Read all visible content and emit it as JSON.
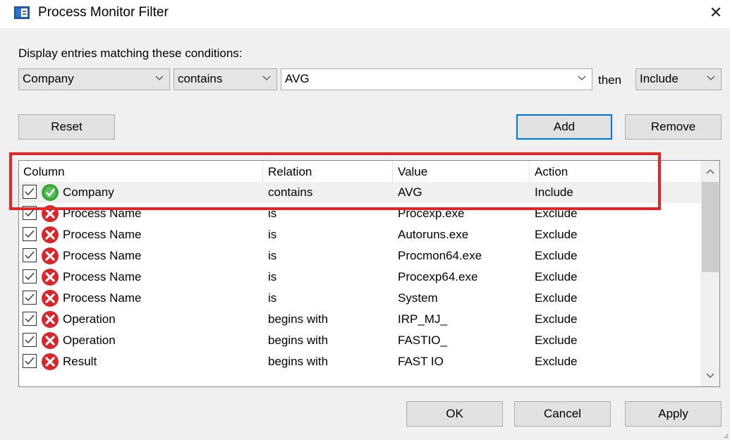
{
  "window": {
    "title": "Process Monitor Filter",
    "close_glyph": "✕"
  },
  "conditions_label": "Display entries matching these conditions:",
  "condition": {
    "column": "Company",
    "relation": "contains",
    "value": "AVG",
    "then_label": "then",
    "action": "Include"
  },
  "buttons": {
    "reset": "Reset",
    "add": "Add",
    "remove": "Remove",
    "ok": "OK",
    "cancel": "Cancel",
    "apply": "Apply"
  },
  "table": {
    "headers": {
      "column": "Column",
      "relation": "Relation",
      "value": "Value",
      "action": "Action"
    },
    "rows": [
      {
        "column": "Company",
        "relation": "contains",
        "value": "AVG",
        "action": "Include",
        "checked": true,
        "status_icon": "include-icon"
      },
      {
        "column": "Process Name",
        "relation": "is",
        "value": "Procexp.exe",
        "action": "Exclude",
        "checked": true,
        "status_icon": "exclude-icon"
      },
      {
        "column": "Process Name",
        "relation": "is",
        "value": "Autoruns.exe",
        "action": "Exclude",
        "checked": true,
        "status_icon": "exclude-icon"
      },
      {
        "column": "Process Name",
        "relation": "is",
        "value": "Procmon64.exe",
        "action": "Exclude",
        "checked": true,
        "status_icon": "exclude-icon"
      },
      {
        "column": "Process Name",
        "relation": "is",
        "value": "Procexp64.exe",
        "action": "Exclude",
        "checked": true,
        "status_icon": "exclude-icon"
      },
      {
        "column": "Process Name",
        "relation": "is",
        "value": "System",
        "action": "Exclude",
        "checked": true,
        "status_icon": "exclude-icon"
      },
      {
        "column": "Operation",
        "relation": "begins with",
        "value": "IRP_MJ_",
        "action": "Exclude",
        "checked": true,
        "status_icon": "exclude-icon"
      },
      {
        "column": "Operation",
        "relation": "begins with",
        "value": "FASTIO_",
        "action": "Exclude",
        "checked": true,
        "status_icon": "exclude-icon"
      },
      {
        "column": "Result",
        "relation": "begins with",
        "value": "FAST IO",
        "action": "Exclude",
        "checked": true,
        "status_icon": "exclude-icon"
      }
    ]
  },
  "colors": {
    "accent": "#0078d7",
    "annotation": "#e1262c",
    "include": "#3aa83a",
    "exclude": "#d9262b"
  }
}
